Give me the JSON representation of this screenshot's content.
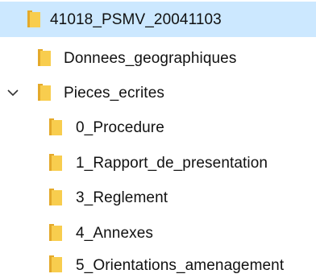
{
  "colors": {
    "selection_background": "#cce8ff",
    "folder_fill": "#f8cd4e",
    "folder_shade": "#e4a92a",
    "chevron": "#333333"
  },
  "tree": {
    "items": [
      {
        "label": "41018_PSMV_20041103",
        "icon": "folder-icon",
        "selected": true,
        "expandable": false
      },
      {
        "label": "Donnees_geographiques",
        "icon": "folder-icon",
        "selected": false,
        "expandable": false
      },
      {
        "label": "Pieces_ecrites",
        "icon": "folder-icon",
        "selected": false,
        "expandable": true,
        "expanded": true,
        "expander_icon": "chevron-down-icon"
      },
      {
        "label": "0_Procedure",
        "icon": "folder-icon",
        "selected": false,
        "expandable": false
      },
      {
        "label": "1_Rapport_de_presentation",
        "icon": "folder-icon",
        "selected": false,
        "expandable": false
      },
      {
        "label": "3_Reglement",
        "icon": "folder-icon",
        "selected": false,
        "expandable": false
      },
      {
        "label": "4_Annexes",
        "icon": "folder-icon",
        "selected": false,
        "expandable": false
      },
      {
        "label": "5_Orientations_amenagement",
        "icon": "folder-icon",
        "selected": false,
        "expandable": false
      }
    ]
  }
}
